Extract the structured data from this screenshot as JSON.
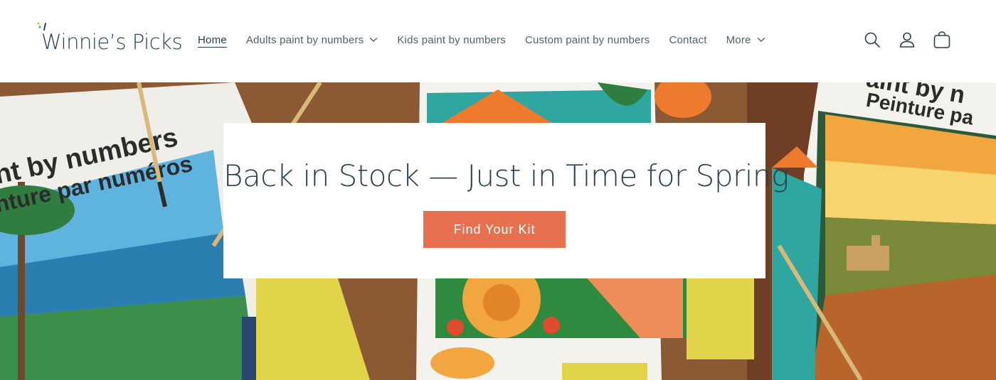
{
  "brand": {
    "name": "Winnie’s Picks"
  },
  "nav": {
    "items": [
      {
        "label": "Home",
        "active": true,
        "has_dropdown": false
      },
      {
        "label": "Adults paint by numbers",
        "active": false,
        "has_dropdown": true
      },
      {
        "label": "Kids paint by numbers",
        "active": false,
        "has_dropdown": false
      },
      {
        "label": "Custom paint by numbers",
        "active": false,
        "has_dropdown": false
      },
      {
        "label": "Contact",
        "active": false,
        "has_dropdown": false
      },
      {
        "label": "More",
        "active": false,
        "has_dropdown": true
      }
    ]
  },
  "header_icons": [
    "search-icon",
    "account-icon",
    "cart-icon"
  ],
  "hero": {
    "title": "Back in Stock — Just in Time for Spring",
    "button_label": "Find Your Kit",
    "box_text_left": [
      "nt by numbers",
      "nture par numéros"
    ],
    "box_text_right": [
      "aint by n",
      "Peinture pa"
    ],
    "accent_color": "#e7714f"
  }
}
